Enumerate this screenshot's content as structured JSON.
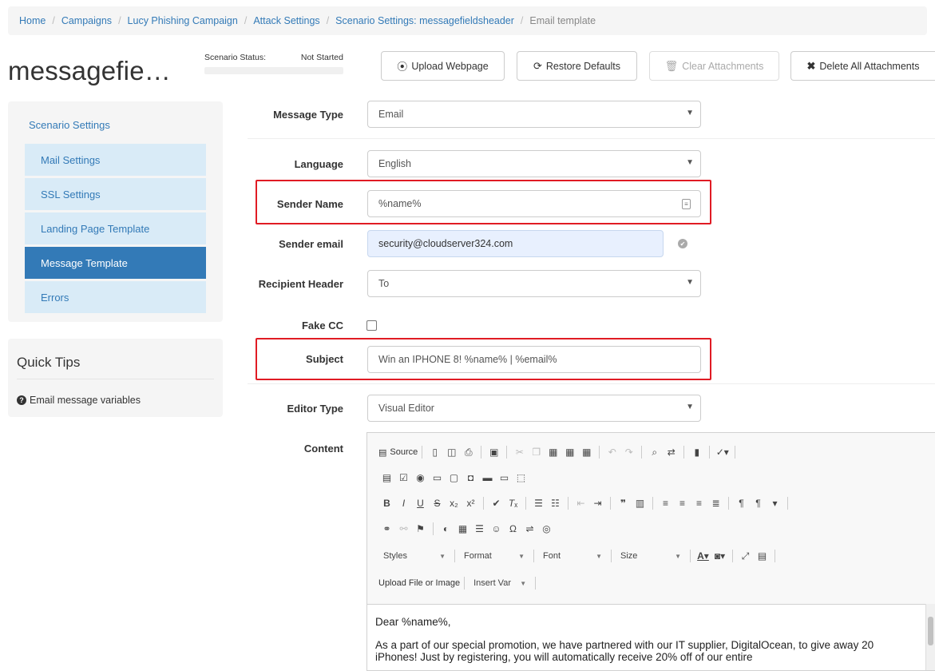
{
  "breadcrumb": {
    "items": [
      "Home",
      "Campaigns",
      "Lucy Phishing Campaign",
      "Attack Settings",
      "Scenario Settings: messagefieldsheader"
    ],
    "current": "Email template"
  },
  "header": {
    "title": "messagefie…",
    "status_label": "Scenario Status:",
    "status_value": "Not Started",
    "buttons": {
      "upload": "Upload Webpage",
      "restore": "Restore Defaults",
      "clear": "Clear Attachments",
      "delete": "Delete All Attachments"
    }
  },
  "sidebar": {
    "heading": "Scenario Settings",
    "items": [
      {
        "label": "Mail Settings",
        "active": false
      },
      {
        "label": "SSL Settings",
        "active": false
      },
      {
        "label": "Landing Page Template",
        "active": false
      },
      {
        "label": "Message Template",
        "active": true
      },
      {
        "label": "Errors",
        "active": false
      }
    ]
  },
  "tips": {
    "title": "Quick Tips",
    "link": "Email message variables"
  },
  "form": {
    "message_type": {
      "label": "Message Type",
      "value": "Email"
    },
    "language": {
      "label": "Language",
      "value": "English"
    },
    "sender_name": {
      "label": "Sender Name",
      "value": "%name%"
    },
    "sender_email": {
      "label": "Sender email",
      "value": "security@cloudserver324.com"
    },
    "recipient_header": {
      "label": "Recipient Header",
      "value": "To"
    },
    "fake_cc": {
      "label": "Fake CC",
      "checked": false
    },
    "subject": {
      "label": "Subject",
      "value": "Win an IPHONE 8! %name% | %email%"
    },
    "editor_type": {
      "label": "Editor Type",
      "value": "Visual Editor"
    },
    "content": {
      "label": "Content"
    }
  },
  "editor": {
    "source_label": "Source",
    "combos": {
      "styles": "Styles",
      "format": "Format",
      "font": "Font",
      "size": "Size"
    },
    "upload_label": "Upload File or Image",
    "insert_var_label": "Insert Var",
    "body": {
      "greeting": "Dear %name%,",
      "paragraph": "As a part of our special promotion, we have partnered with our IT supplier, DigitalOcean, to give away 20 iPhones! Just by registering, you will automatically receive 20% off of our entire"
    }
  },
  "colors": {
    "link": "#337ab7",
    "active_nav": "#337ab7",
    "nav_item_bg": "#d9ebf7",
    "highlight": "#e01b24",
    "autofill_bg": "#e8f0fe"
  }
}
